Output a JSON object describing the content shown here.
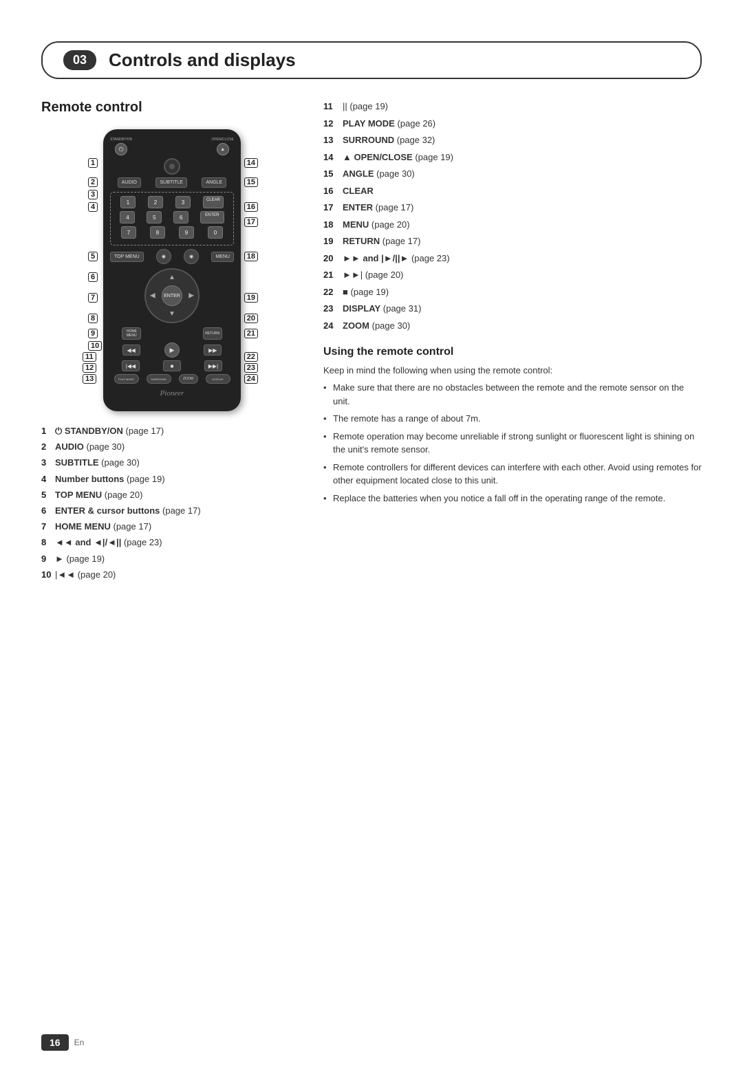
{
  "header": {
    "chapter": "03",
    "title": "Controls and displays"
  },
  "section": {
    "remote_control_title": "Remote control",
    "using_remote_title": "Using the remote control",
    "using_remote_subtitle": "Keep in mind the following when using the remote control:",
    "bullets": [
      "Make sure that there are no obstacles between the remote and the remote sensor on the unit.",
      "The remote has a range of about 7m.",
      "Remote operation may become unreliable if strong sunlight or fluorescent light is shining on the unit's remote sensor.",
      "Remote controllers for different devices can interfere with each other. Avoid using remotes for other equipment located close to this unit.",
      "Replace the batteries when you notice a fall off in the operating range of the remote."
    ]
  },
  "left_list": [
    {
      "num": "1",
      "text": " STANDBY/ON",
      "bold": true,
      "suffix": " (page 17)"
    },
    {
      "num": "2",
      "text": "AUDIO",
      "bold": true,
      "suffix": " (page 30)"
    },
    {
      "num": "3",
      "text": "SUBTITLE",
      "bold": true,
      "suffix": " (page 30)"
    },
    {
      "num": "4",
      "text": "Number buttons",
      "bold": true,
      "suffix": " (page 19)"
    },
    {
      "num": "5",
      "text": "TOP MENU",
      "bold": true,
      "suffix": " (page 20)"
    },
    {
      "num": "6",
      "text": "ENTER & cursor buttons",
      "bold": true,
      "suffix": " (page 17)"
    },
    {
      "num": "7",
      "text": "HOME MENU",
      "bold": true,
      "suffix": " (page 17)"
    },
    {
      "num": "8",
      "text": "◄◄ and ◄|/◄||",
      "bold": true,
      "suffix": " (page 23)"
    },
    {
      "num": "9",
      "text": "►",
      "bold": false,
      "suffix": " (page 19)"
    },
    {
      "num": "10",
      "text": "|◄◄",
      "bold": false,
      "suffix": " (page 20)"
    }
  ],
  "right_list": [
    {
      "num": "11",
      "text": "||",
      "bold": false,
      "suffix": " (page 19)"
    },
    {
      "num": "12",
      "text": "PLAY MODE",
      "bold": true,
      "suffix": " (page 26)"
    },
    {
      "num": "13",
      "text": "SURROUND",
      "bold": true,
      "suffix": " (page 32)"
    },
    {
      "num": "14",
      "text": "▲ OPEN/CLOSE",
      "bold": true,
      "suffix": " (page 19)"
    },
    {
      "num": "15",
      "text": "ANGLE",
      "bold": true,
      "suffix": " (page 30)"
    },
    {
      "num": "16",
      "text": "CLEAR",
      "bold": true,
      "suffix": ""
    },
    {
      "num": "17",
      "text": "ENTER",
      "bold": true,
      "suffix": " (page 17)"
    },
    {
      "num": "18",
      "text": "MENU",
      "bold": true,
      "suffix": " (page 20)"
    },
    {
      "num": "19",
      "text": "RETURN",
      "bold": true,
      "suffix": " (page 17)"
    },
    {
      "num": "20",
      "text": "►► and |►/||►",
      "bold": true,
      "suffix": " (page 23)"
    },
    {
      "num": "21",
      "text": "►►|",
      "bold": false,
      "suffix": " (page 20)"
    },
    {
      "num": "22",
      "text": "■",
      "bold": false,
      "suffix": " (page 19)"
    },
    {
      "num": "23",
      "text": "DISPLAY",
      "bold": true,
      "suffix": " (page 31)"
    },
    {
      "num": "24",
      "text": "ZOOM",
      "bold": true,
      "suffix": " (page 30)"
    }
  ],
  "footer": {
    "page_num": "16",
    "lang": "En"
  },
  "remote": {
    "brand": "Pioneer",
    "buttons": {
      "standby": "⏻",
      "open_close": "▲",
      "audio": "AUDIO",
      "subtitle": "SUBTITLE",
      "angle": "ANGLE",
      "top_menu": "TOP MENU",
      "menu": "MENU",
      "enter": "ENTER",
      "home_menu": "HOME MENU",
      "return": "RETURN",
      "clear": "CLEAR",
      "play_mode": "PLAY MODE",
      "surround": "SURROUND",
      "zoom": "ZOOM",
      "display": "DISPLAY"
    }
  }
}
